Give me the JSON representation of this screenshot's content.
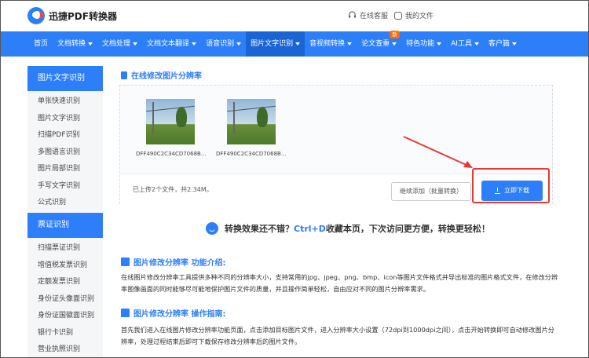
{
  "header": {
    "brand": "迅捷PDF转换器",
    "service": "在线客服",
    "myfiles": "我的文件"
  },
  "nav": {
    "items": [
      {
        "label": "首页"
      },
      {
        "label": "文档转换"
      },
      {
        "label": "文档处理"
      },
      {
        "label": "文档文本翻译"
      },
      {
        "label": "语音识别"
      },
      {
        "label": "图片文字识别"
      },
      {
        "label": "音视频转换"
      },
      {
        "label": "论文查重",
        "badge": "新"
      },
      {
        "label": "特色功能"
      },
      {
        "label": "AI工具"
      },
      {
        "label": "客户篇"
      }
    ]
  },
  "sidebar": {
    "group1": {
      "title": "图片文字识别",
      "items": [
        "单张快速识别",
        "图片文字识别",
        "扫描PDF识别",
        "多图语言识别",
        "图片局部识别",
        "手写文字识别",
        "公式识别"
      ]
    },
    "group2": {
      "title": "票证识别",
      "items": [
        "扫描票证识别",
        "增值税发票识别",
        "定额发票识别",
        "身份证头像面识别",
        "身份证国徽面识别",
        "银行卡识别",
        "营业执照识别"
      ]
    }
  },
  "main": {
    "section_title": "在线修改图片分辨率",
    "files": [
      {
        "name": "DFF490C2C34CD7068B..."
      },
      {
        "name": "DFF490C2C34CD7068B..."
      }
    ],
    "upload_status": "已上传2个文件，共2.34M。",
    "batch_button": "继续添加（批量转换）",
    "download_button": "立即下载",
    "tip_prefix": "转换效果还不错？",
    "tip_highlight": "Ctrl+D",
    "tip_suffix": "收藏本页，下次访问更方便，转换更轻松！",
    "intro_title": "图片修改分辨率 功能介绍:",
    "intro_text": "在线图片修改分辨率工具提供多种不同的分辨率大小，支持常用的jpg、jpeg、png、bmp、icon等图片文件格式并导出标准的图片格式文件，在修改分辨率图像画面的同时能够尽可能地保护图片文件的质量，并且操作简单轻松，自由应对不同的图片分辨率需求。",
    "guide_title": "图片修改分辨率 操作指南:",
    "guide_text": "首先我们进入在线图片修改分辨率功能页面，点击添加目标图片文件，进入分辨率大小设置（72dpi到1000dpi之间），点击开始转换即可自动修改图片分辨率，处理过程结束后即可下载保存修改分辨率后的图片文件。"
  },
  "colors": {
    "primary": "#2d7ff9",
    "annotation": "#e53935"
  }
}
